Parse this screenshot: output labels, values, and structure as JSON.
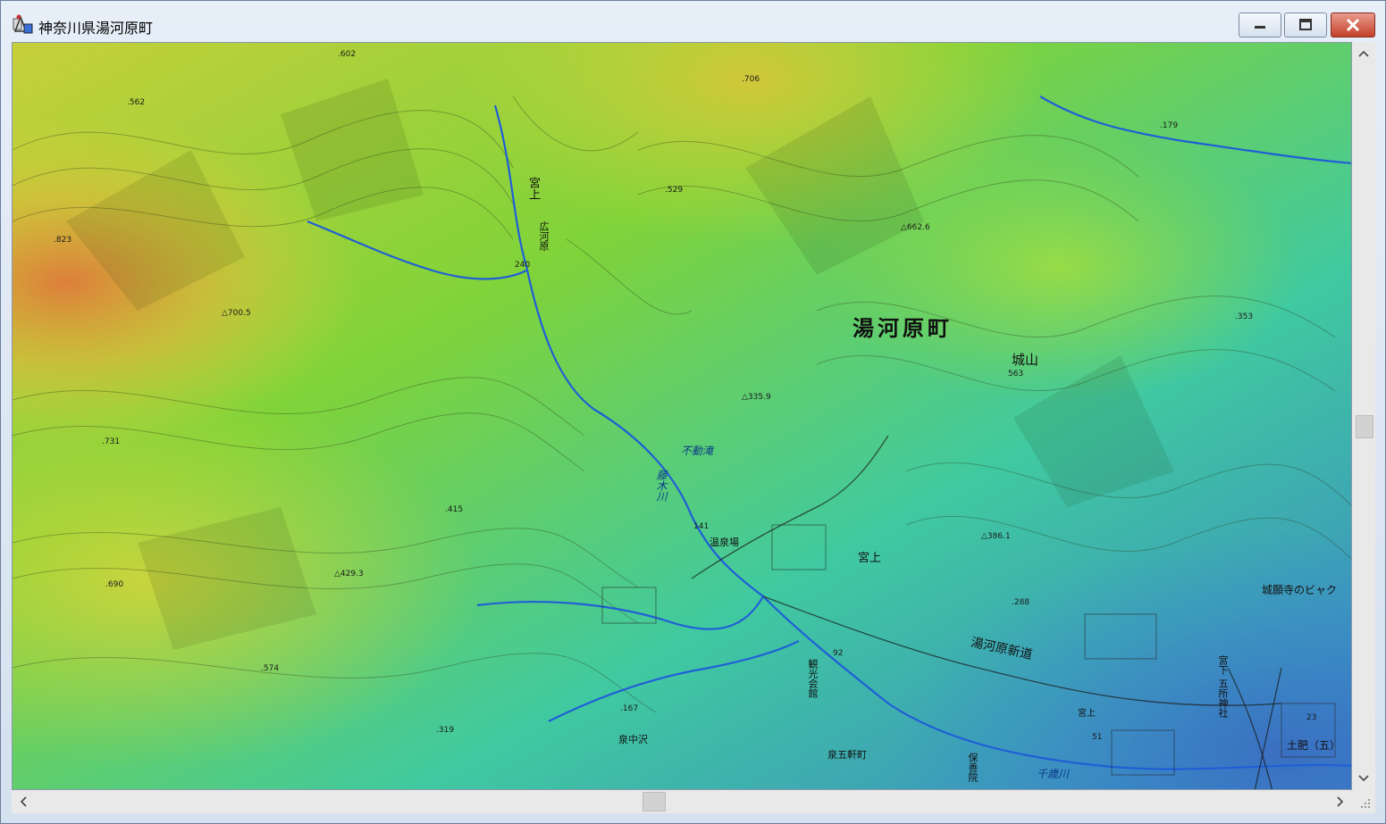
{
  "window": {
    "title": "神奈川県湯河原町",
    "icon": "app-map-icon",
    "controls": [
      "minimize-icon",
      "maximize-icon",
      "close-icon"
    ]
  },
  "map": {
    "town_name": "湯河原町",
    "places": {
      "shiroyama": "城山",
      "miyanoue_center": "宮上",
      "miyanoue_north": "宮上",
      "hirokawara": "広河原",
      "fudotaki": "不動滝",
      "fujikigawa": "藤木川",
      "onsenba": "温泉場",
      "kanko_kaikan": "観光会館",
      "izumigoken": "泉五軒町",
      "izuminakazawa": "泉中沢",
      "chigawa": "千歳川",
      "new_road": "湯河原新道",
      "joganji": "城願寺のビャク",
      "miyashita": "宮下",
      "goshojinja": "五所神社",
      "hoshuin": "保善院",
      "dohi": "土肥（五）",
      "miyakami_s": "宮上"
    },
    "spot_heights": {
      "h602": ".602",
      "h706": ".706",
      "h562": ".562",
      "h179": ".179",
      "h529": ".529",
      "h823": ".823",
      "h662": "△662.6",
      "h240": "240",
      "h700": "△700.5",
      "h353": ".353",
      "h563": "563",
      "h335": "△335.9",
      "h731": ".731",
      "h415": ".415",
      "h141": "141",
      "h386": "△386.1",
      "h429": "△429.3",
      "h690": ".690",
      "h288": ".288",
      "h92": "92",
      "h574": ".574",
      "h167": ".167",
      "h319": ".319",
      "h51": "51",
      "h23": "23"
    },
    "colors": {
      "high": "#e07a3a",
      "mid_high": "#d6d43a",
      "mid": "#7fd33a",
      "low": "#3ec98f",
      "lowest": "#3a8fd6",
      "river": "#1f5fd6",
      "contour": "#2a3a1a"
    }
  },
  "scrollbars": {
    "vertical": [
      "scroll-up-icon",
      "scroll-down-icon"
    ],
    "horizontal": [
      "scroll-left-icon",
      "scroll-right-icon"
    ],
    "grip": "resize-grip-icon"
  }
}
